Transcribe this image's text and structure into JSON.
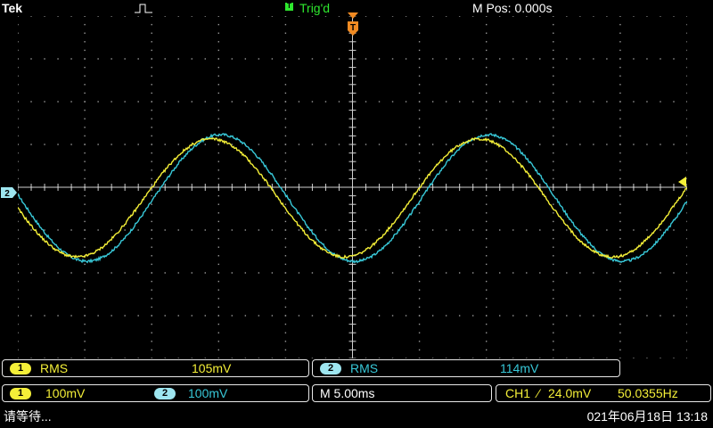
{
  "topbar": {
    "brand": "Tek",
    "trigger_badge": "T",
    "trigger_status": "Trig'd",
    "horizontal_position": "M Pos: 0.000s"
  },
  "markers": {
    "ch2_level": "2",
    "trigger_position": "T"
  },
  "measurements": [
    {
      "channel": "1",
      "type": "RMS",
      "value": "105mV"
    },
    {
      "channel": "2",
      "type": "RMS",
      "value": "114mV"
    }
  ],
  "channels": [
    {
      "channel": "1",
      "scale": "100mV"
    },
    {
      "channel": "2",
      "scale": "100mV"
    }
  ],
  "timebase": "M 5.00ms",
  "trigger": {
    "source": "CH1",
    "slope_symbol": "⁄",
    "level": "24.0mV",
    "frequency": "50.0355Hz"
  },
  "status": {
    "message": "请等待...",
    "datetime": "021年06月18日 13:18"
  },
  "colors": {
    "ch1": "#f4ef38",
    "ch2": "#38c8d8",
    "grid": "#9a9a9a",
    "trigger": "#f08a22"
  },
  "chart_data": {
    "type": "line",
    "x_divisions": 10,
    "y_divisions": 8,
    "time_per_div_ms": 5.0,
    "volts_per_div_mV": 100,
    "series": [
      {
        "name": "1",
        "amplitude_div": 1.38,
        "offset_div": -0.25,
        "period_div": 4.0,
        "phase_deg": 10
      },
      {
        "name": "2",
        "amplitude_div": 1.48,
        "offset_div": -0.25,
        "period_div": 4.0,
        "phase_deg": -3
      }
    ]
  }
}
